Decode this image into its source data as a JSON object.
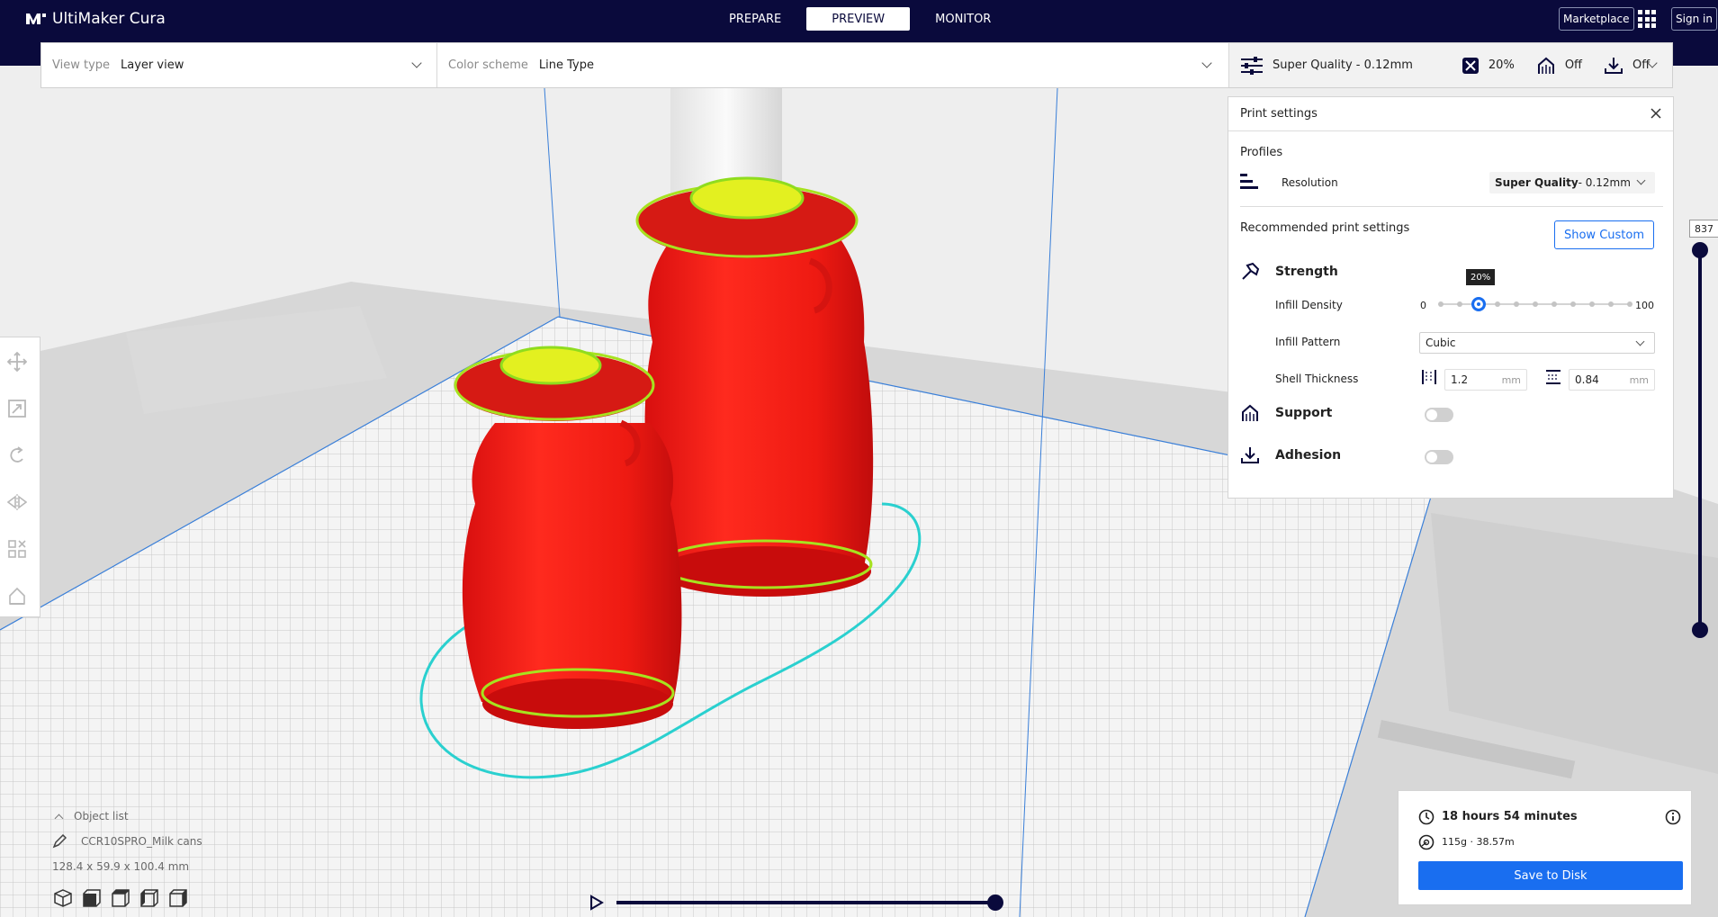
{
  "app": {
    "name": "UltiMaker Cura",
    "logo_icon": "ultimaker-logo-icon",
    "brand_color": "#0a0a3c",
    "accent_color": "#196ef0"
  },
  "stages": [
    {
      "label": "PREPARE",
      "active": false
    },
    {
      "label": "PREVIEW",
      "active": true
    },
    {
      "label": "MONITOR",
      "active": false
    }
  ],
  "header_right": {
    "marketplace_label": "Marketplace",
    "apps_icon": "grid-apps-icon",
    "signin_label": "Sign in"
  },
  "toolbar": {
    "view_type_label": "View type",
    "view_type_value": "Layer view",
    "color_scheme_label": "Color scheme",
    "color_scheme_value": "Line Type",
    "quality": "Super Quality - 0.12mm",
    "infill": "20%",
    "support": "Off",
    "adhesion": "Off"
  },
  "print_settings": {
    "title": "Print settings",
    "profiles_label": "Profiles",
    "resolution_label": "Resolution",
    "resolution_value_bold": "Super Quality",
    "resolution_value_rest": " - 0.12mm",
    "recommended_label": "Recommended print settings",
    "show_custom_label": "Show Custom",
    "strength_label": "Strength",
    "infill_density_label": "Infill Density",
    "infill_min": "0",
    "infill_max": "100",
    "infill_value": 20,
    "infill_tooltip": "20%",
    "infill_pattern_label": "Infill Pattern",
    "infill_pattern_value": "Cubic",
    "shell_thickness_label": "Shell Thickness",
    "wall_thickness": "1.2",
    "top_bottom_thickness": "0.84",
    "unit": "mm",
    "support_label": "Support",
    "support_enabled": false,
    "adhesion_label": "Adhesion",
    "adhesion_enabled": false
  },
  "layer_slider": {
    "current_layer": "837"
  },
  "object_list": {
    "toggle_label": "Object list",
    "object_name": "CCR10SPRO_Milk cans",
    "dimensions": "128.4 x 59.9 x 100.4 mm"
  },
  "job": {
    "print_time": "18 hours 54 minutes",
    "material": "115g · 38.57m",
    "save_label": "Save to Disk"
  }
}
